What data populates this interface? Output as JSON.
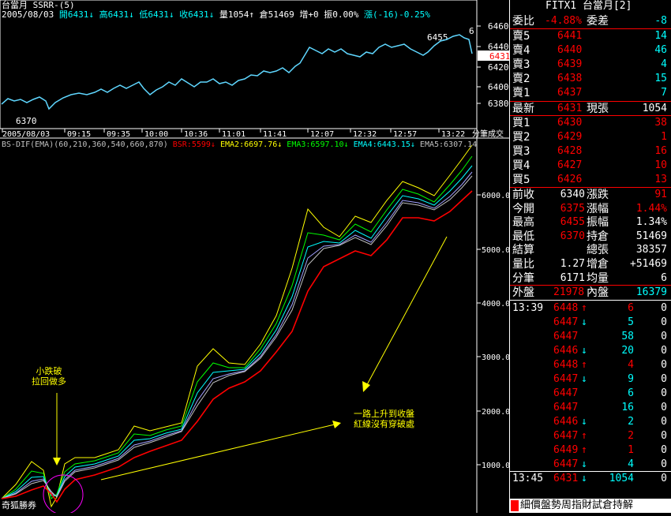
{
  "header": {
    "line1": "台當月 SSRR-(5)",
    "date": "2005/08/03",
    "open": "開6431",
    "high": "高6431",
    "low": "低6431",
    "close": "收6431",
    "vol": "量1054",
    "oi": "倉51469",
    "chg": "增+0",
    "amp": "振0.00%",
    "rise": "漲(-16)-0.25%"
  },
  "price_chart": {
    "y_ticks": [
      "6460",
      "6440",
      "6420",
      "6400",
      "6380"
    ],
    "peak_label": "6455",
    "low_label": "6370",
    "last_label": "6431",
    "edge_label": "6",
    "x_ticks": [
      "2005/08/03",
      "09:15",
      "09:35",
      "10:00",
      "10:36",
      "11:01",
      "11:41",
      "12:07",
      "12:32",
      "12:57",
      "13:22"
    ],
    "x_end_label": "分筆成交"
  },
  "indicator": {
    "title": "BS-DIF(EMA)(60,210,360,540,660,870)",
    "bsr": "BSR:5599",
    "ema2": "EMA2:6697.76",
    "ema3": "EMA3:6597.10",
    "ema4": "EMA4:6443.15",
    "ema5": "EMA5:6307.14",
    "y_ticks": [
      "6000.0",
      "5000.0",
      "4000.0",
      "3000.0",
      "2000.0",
      "1000.0"
    ],
    "bottom_label": "奇狐勝券",
    "colors": {
      "bsr": "#ff0000",
      "ema1": "#ffff00",
      "ema2": "#00ff00",
      "ema3": "#00ffff",
      "ema4": "#a0a0ff",
      "ema5": "#c0c0c0"
    }
  },
  "annotations": {
    "left_1": "小跌破",
    "left_2": "拉回做多",
    "right_1": "一路上升到收盤",
    "right_2": "紅線沒有穿破處"
  },
  "panel": {
    "title": "FITX1 台當月[2]",
    "ratio_label": "委比",
    "ratio_val": "-4.88%",
    "diff_label": "委差",
    "diff_val": "-8",
    "asks": [
      {
        "label": "賣5",
        "price": "6441",
        "qty": "14"
      },
      {
        "label": "賣4",
        "price": "6440",
        "qty": "46"
      },
      {
        "label": "賣3",
        "price": "6439",
        "qty": "4"
      },
      {
        "label": "賣2",
        "price": "6438",
        "qty": "15"
      },
      {
        "label": "賣1",
        "price": "6437",
        "qty": "7"
      }
    ],
    "last_label": "最新",
    "last_price": "6431",
    "cur_label": "現張",
    "cur_val": "1054",
    "bids": [
      {
        "label": "買1",
        "price": "6430",
        "qty": "38"
      },
      {
        "label": "買2",
        "price": "6429",
        "qty": "1"
      },
      {
        "label": "買3",
        "price": "6428",
        "qty": "16"
      },
      {
        "label": "買4",
        "price": "6427",
        "qty": "10"
      },
      {
        "label": "買5",
        "price": "6426",
        "qty": "13"
      }
    ],
    "stats": [
      {
        "l1": "前收",
        "v1": "6340",
        "l2": "漲跌",
        "v2": "91",
        "c1": "#ffffff",
        "c2": "#ff0000"
      },
      {
        "l1": "今開",
        "v1": "6375",
        "l2": "漲幅",
        "v2": "1.44%",
        "c1": "#ff0000",
        "c2": "#ff0000"
      },
      {
        "l1": "最高",
        "v1": "6455",
        "l2": "振幅",
        "v2": "1.34%",
        "c1": "#ff0000",
        "c2": "#ffffff"
      },
      {
        "l1": "最低",
        "v1": "6370",
        "l2": "持倉",
        "v2": "51469",
        "c1": "#ff0000",
        "c2": "#ffffff"
      },
      {
        "l1": "結算",
        "v1": "",
        "l2": "總張",
        "v2": "38357",
        "c1": "#ffffff",
        "c2": "#ffffff"
      },
      {
        "l1": "量比",
        "v1": "1.27",
        "l2": "增倉",
        "v2": "+51469",
        "c1": "#ffffff",
        "c2": "#ffffff"
      },
      {
        "l1": "分筆",
        "v1": "6171",
        "l2": "均量",
        "v2": "6",
        "c1": "#ffffff",
        "c2": "#ffffff"
      }
    ],
    "outer_label": "外盤",
    "outer_val": "21978",
    "inner_label": "內盤",
    "inner_val": "16379",
    "ticks": [
      {
        "time": "13:39",
        "price": "6448",
        "arrow": "↑",
        "qty": "6",
        "oi": "0"
      },
      {
        "time": "",
        "price": "6447",
        "arrow": "↓",
        "qty": "5",
        "oi": "0"
      },
      {
        "time": "",
        "price": "6447",
        "arrow": "",
        "qty": "58",
        "oi": "0"
      },
      {
        "time": "",
        "price": "6446",
        "arrow": "↓",
        "qty": "20",
        "oi": "0"
      },
      {
        "time": "",
        "price": "6448",
        "arrow": "↑",
        "qty": "4",
        "oi": "0"
      },
      {
        "time": "",
        "price": "6447",
        "arrow": "↓",
        "qty": "9",
        "oi": "0"
      },
      {
        "time": "",
        "price": "6447",
        "arrow": "",
        "qty": "6",
        "oi": "0"
      },
      {
        "time": "",
        "price": "6447",
        "arrow": "",
        "qty": "16",
        "oi": "0"
      },
      {
        "time": "",
        "price": "6446",
        "arrow": "↓",
        "qty": "2",
        "oi": "0"
      },
      {
        "time": "",
        "price": "6447",
        "arrow": "↑",
        "qty": "2",
        "oi": "0"
      },
      {
        "time": "",
        "price": "6449",
        "arrow": "↑",
        "qty": "1",
        "oi": "0"
      },
      {
        "time": "",
        "price": "6447",
        "arrow": "↓",
        "qty": "4",
        "oi": "0"
      }
    ],
    "final_tick": {
      "time": "13:45",
      "price": "6431",
      "arrow": "↓",
      "qty": "1054",
      "oi": "0"
    },
    "bottom_bar": "細價盤勢周指財試倉持解"
  }
}
